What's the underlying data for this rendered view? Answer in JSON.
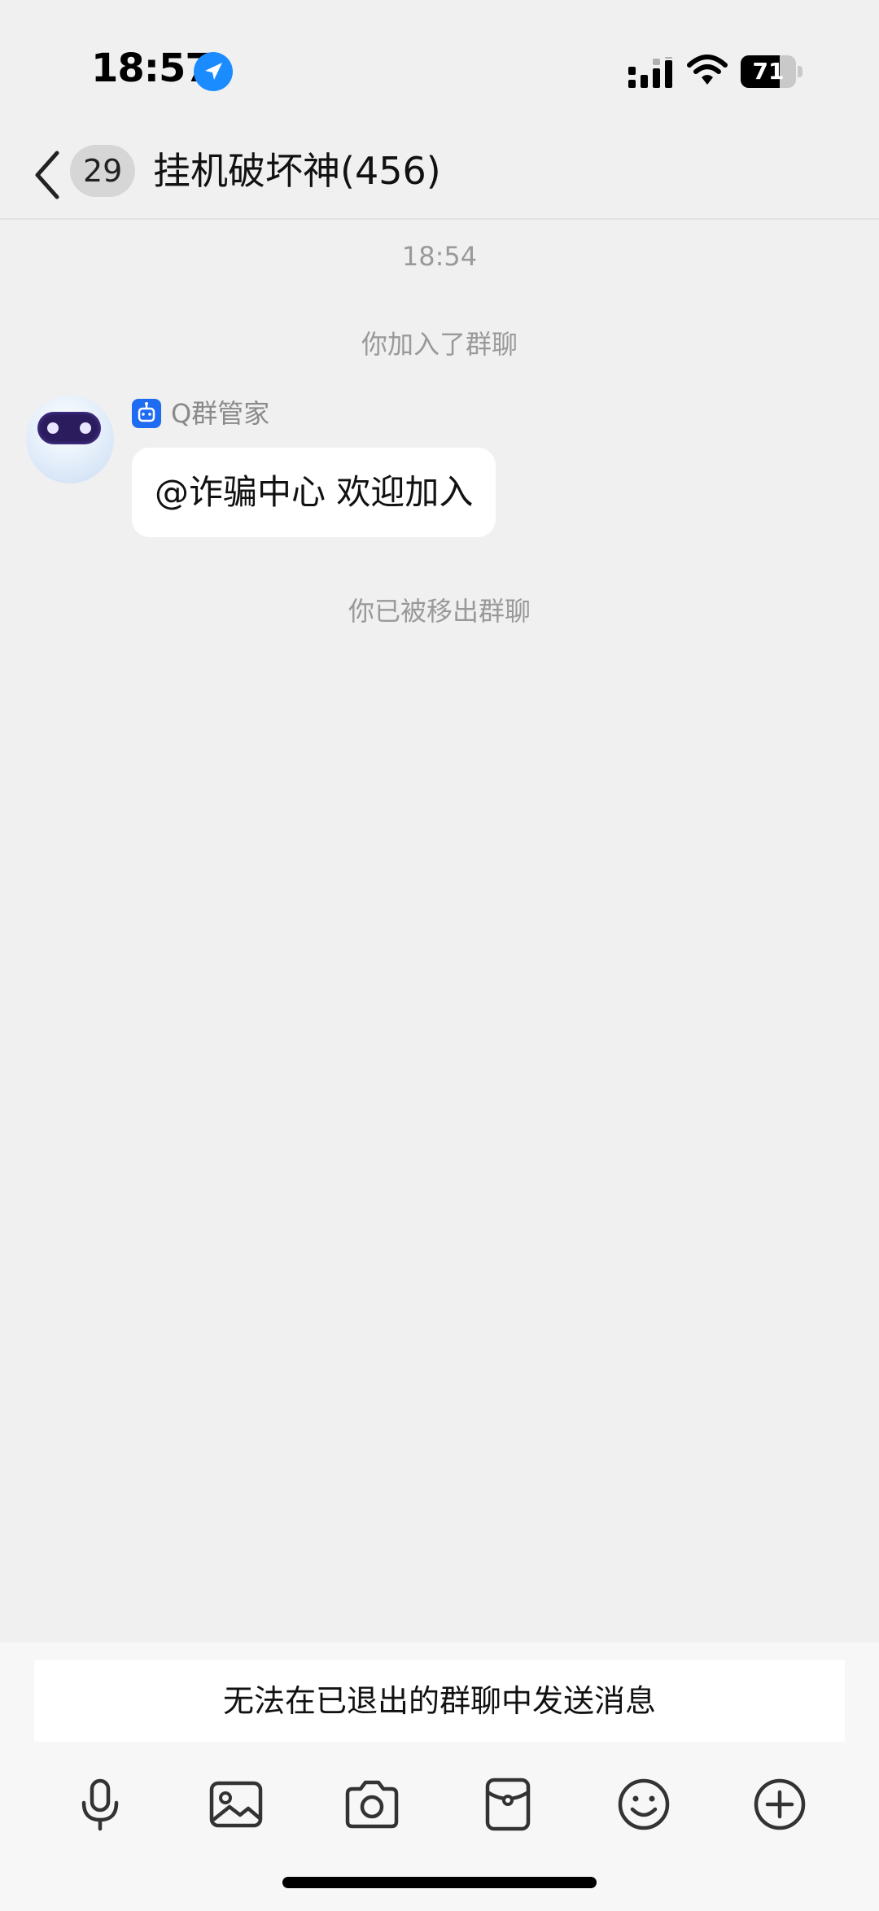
{
  "status_bar": {
    "time": "18:57",
    "battery_level": "71",
    "battery_fraction": 0.71,
    "icons": [
      "location-arrow-icon",
      "cellular-signal-icon",
      "wifi-icon",
      "battery-icon"
    ]
  },
  "header": {
    "unread_count": "29",
    "title": "挂机破坏神(456)",
    "back_icon": "chevron-left-icon"
  },
  "messages": {
    "timestamp": "18:54",
    "joined_notice": "你加入了群聊",
    "sender_name": "Q群管家",
    "bubble_text": "@诈骗中心 欢迎加入",
    "removed_notice": "你已被移出群聊"
  },
  "bottom": {
    "notice": "无法在已退出的群聊中发送消息",
    "toolbar_icons": [
      "microphone-icon",
      "image-icon",
      "camera-icon",
      "red-packet-icon",
      "emoji-icon",
      "plus-icon"
    ]
  },
  "colors": {
    "background": "#f0f0f0",
    "accent_blue": "#1e6cf2",
    "location_blue": "#1a8cff",
    "bubble": "#ffffff",
    "muted_text": "#999999"
  }
}
